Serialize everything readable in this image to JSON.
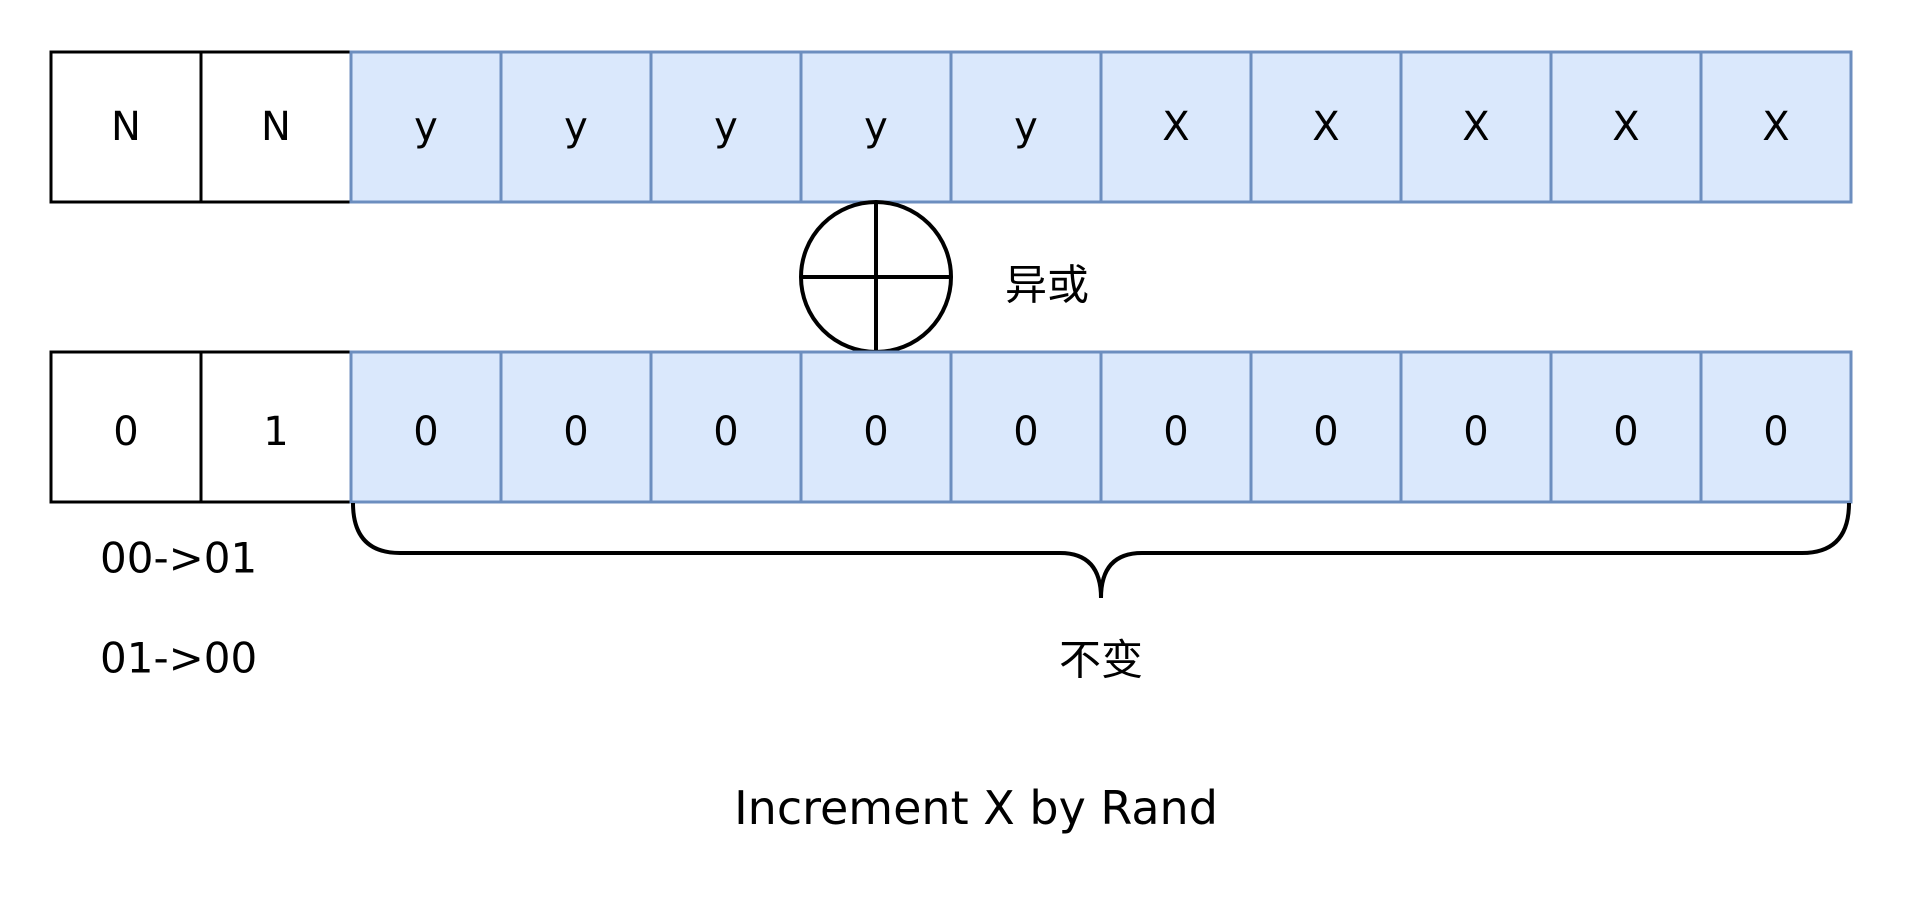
{
  "top_row": {
    "flag_cells": [
      "N",
      "N"
    ],
    "data_cells": [
      "y",
      "y",
      "y",
      "y",
      "y",
      "X",
      "X",
      "X",
      "X",
      "X"
    ]
  },
  "xor": {
    "symbol": "xor-circle-icon",
    "label": "异或"
  },
  "bottom_row": {
    "flag_cells": [
      "0",
      "1"
    ],
    "data_cells": [
      "0",
      "0",
      "0",
      "0",
      "0",
      "0",
      "0",
      "0",
      "0",
      "0"
    ]
  },
  "flag_transitions": [
    "00->01",
    "01->00"
  ],
  "unchanged_label": "不变",
  "caption": "Increment X by Rand",
  "colors": {
    "flag_fill": "#ffffff",
    "flag_stroke": "#000000",
    "data_fill": "#dae8fc",
    "data_stroke": "#6c8ebf"
  }
}
